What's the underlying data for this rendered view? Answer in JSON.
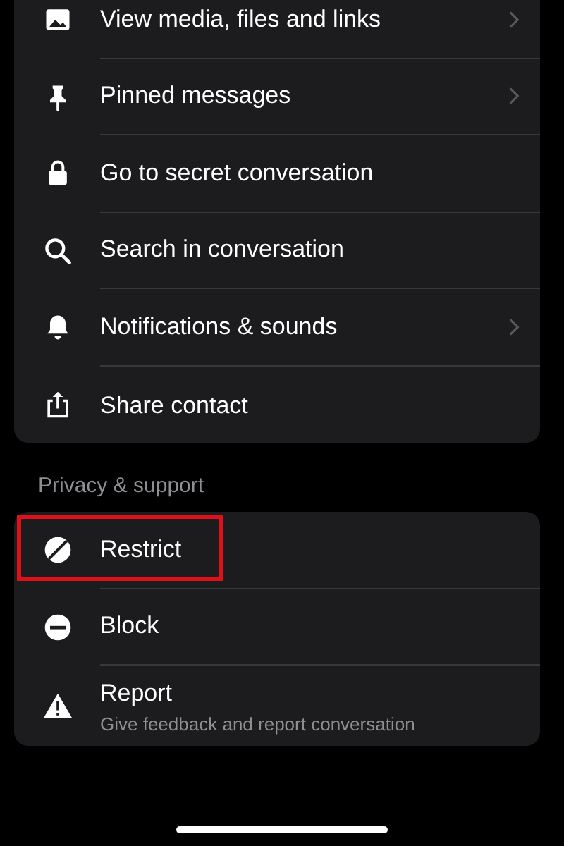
{
  "menu_items": [
    {
      "label": "View media, files and links",
      "chevron": true,
      "highlighted": false
    },
    {
      "label": "Pinned messages",
      "chevron": true,
      "highlighted": false
    },
    {
      "label": "Go to secret conversation",
      "chevron": false,
      "highlighted": false
    },
    {
      "label": "Search in conversation",
      "chevron": false,
      "highlighted": false
    },
    {
      "label": "Notifications & sounds",
      "chevron": true,
      "highlighted": false
    },
    {
      "label": "Share contact",
      "chevron": false,
      "highlighted": false
    }
  ],
  "privacy_section": {
    "heading": "Privacy & support",
    "items": [
      {
        "label": "Restrict",
        "chevron": false,
        "highlighted": true
      },
      {
        "label": "Block",
        "chevron": false,
        "highlighted": false
      },
      {
        "label": "Report",
        "subtitle": "Give feedback and report conversation",
        "chevron": false,
        "highlighted": false
      }
    ]
  }
}
